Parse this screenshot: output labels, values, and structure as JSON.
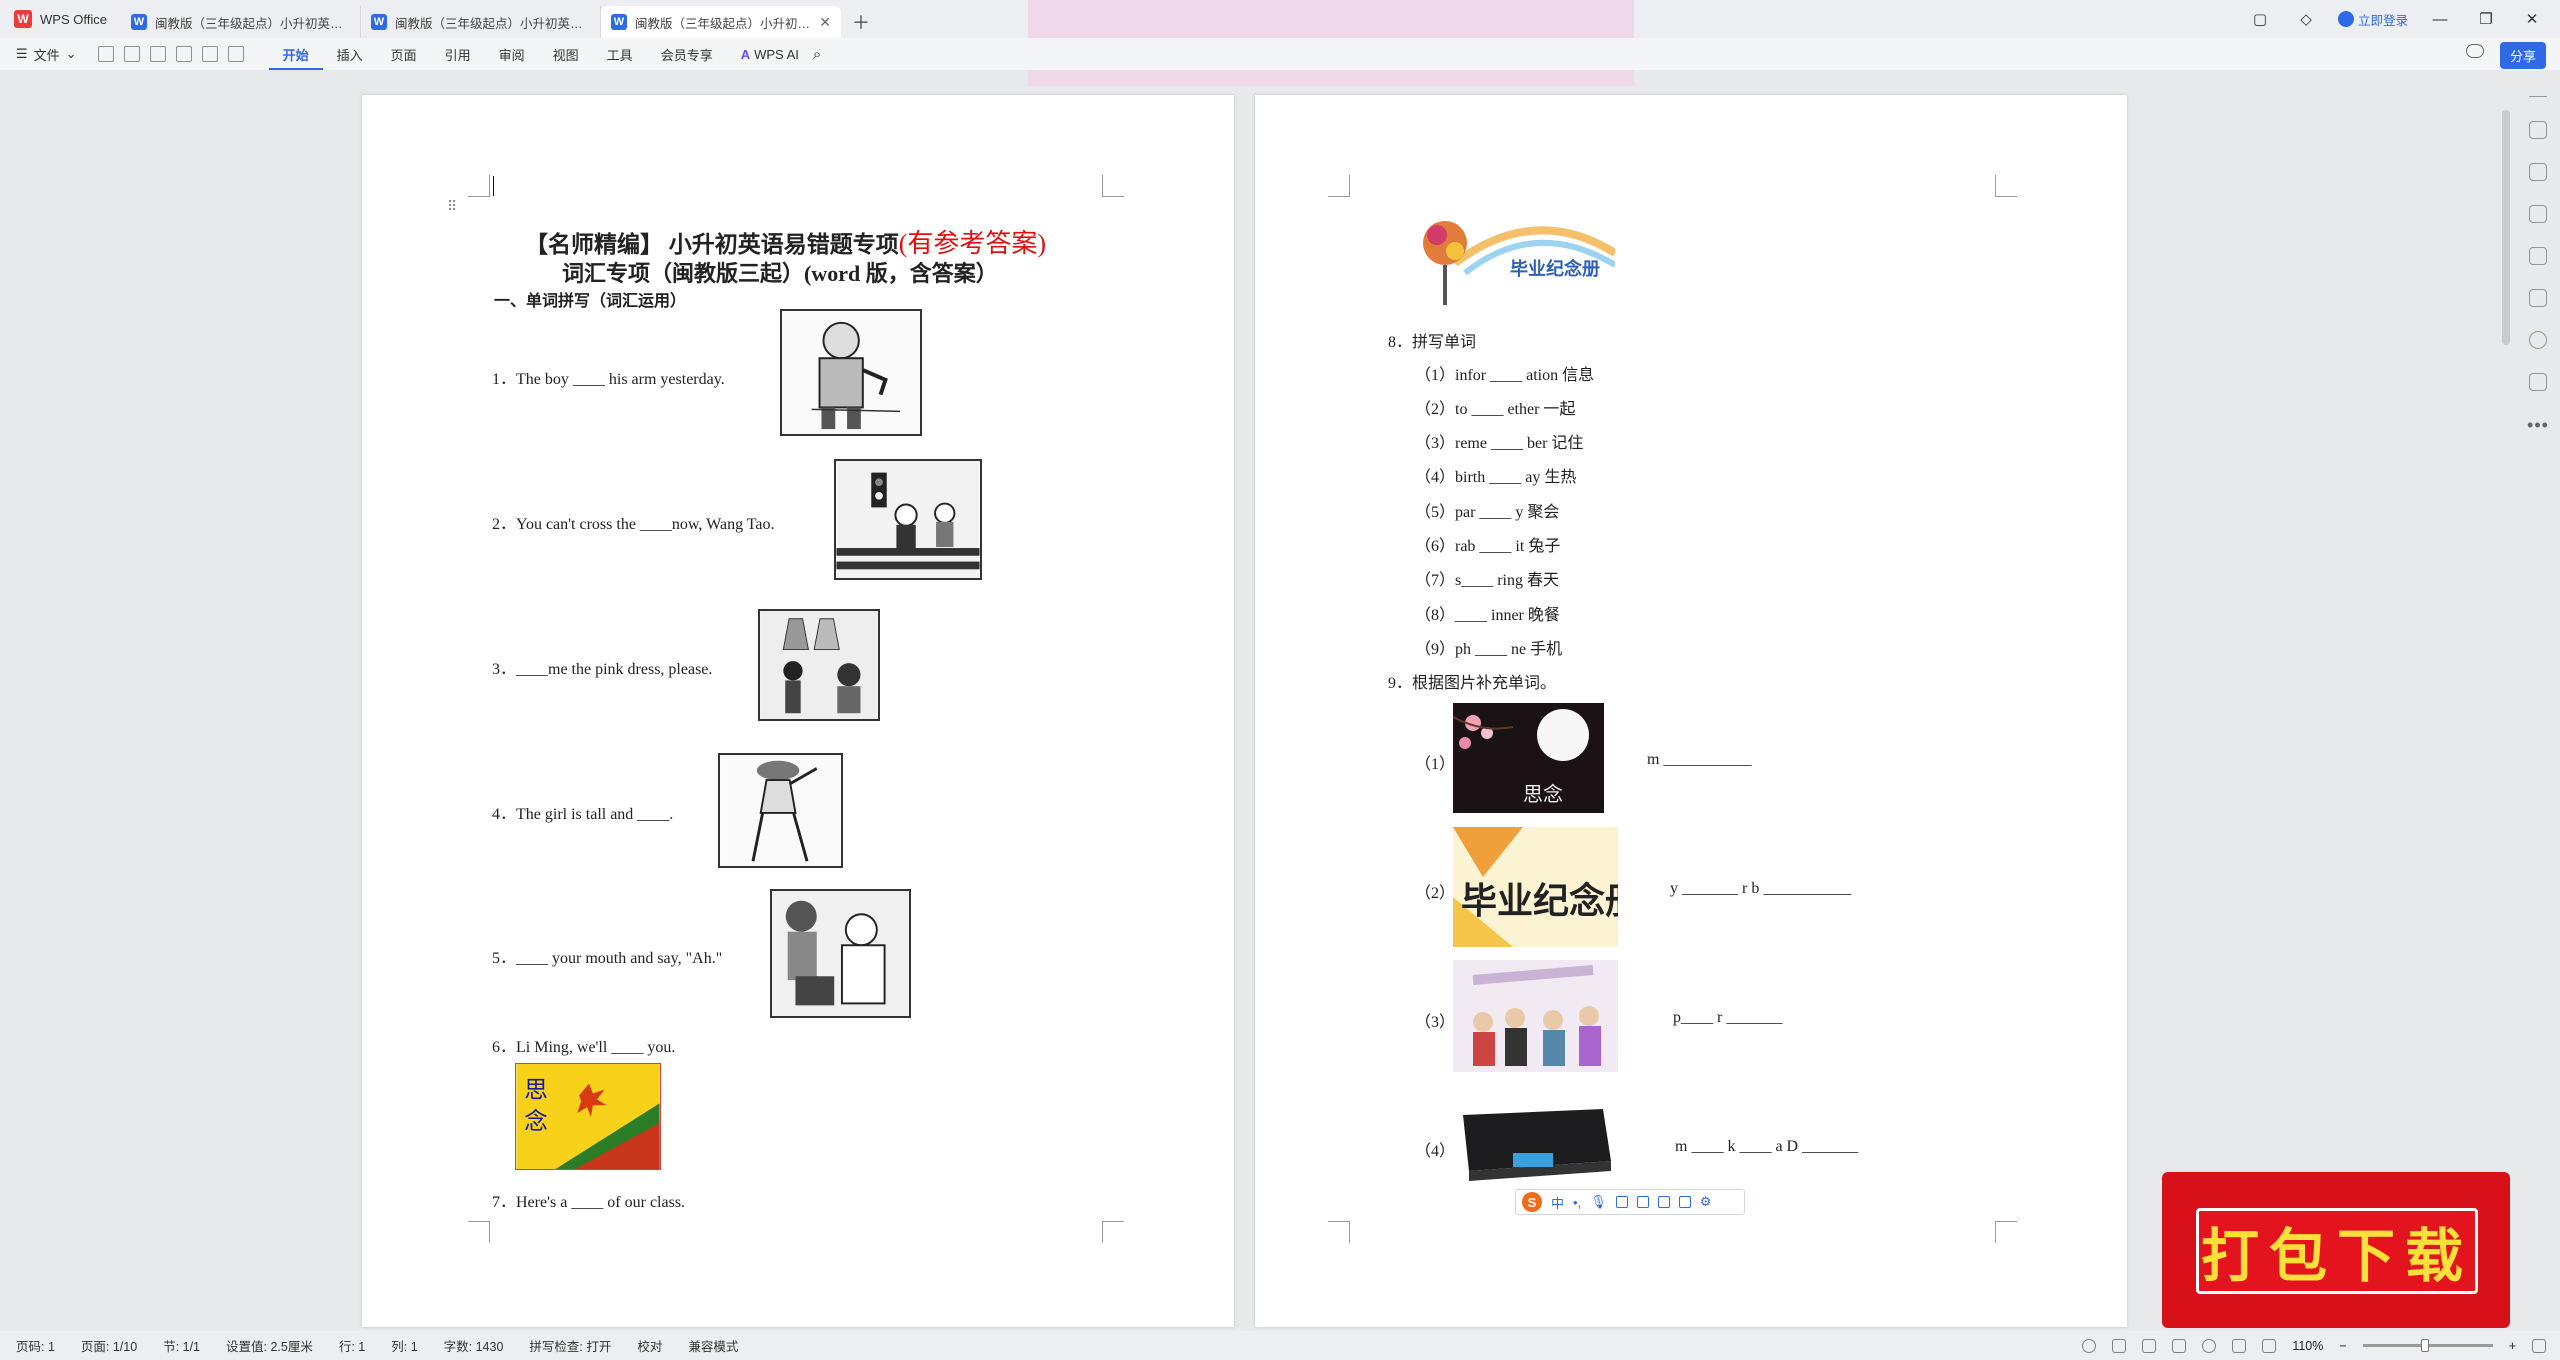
{
  "app": {
    "name": "WPS Office",
    "tabs": [
      {
        "label": "闽教版（三年级起点）小升初英语易错题专项"
      },
      {
        "label": "闽教版（三年级起点）小升初英语易错题专项"
      },
      {
        "label": "闽教版（三年级起点）小升初英语易错题专项"
      }
    ],
    "login": "立即登录"
  },
  "toolbar": {
    "file": "文件",
    "menus": [
      "开始",
      "插入",
      "页面",
      "引用",
      "审阅",
      "视图",
      "工具",
      "会员专享"
    ],
    "wps_ai": "WPS AI",
    "share": "分享"
  },
  "page1": {
    "title_bold": "【名师精编】 小升初英语易错题专项",
    "title_red": "(有参考答案)",
    "subtitle": "词汇专项（闽教版三起）(word 版，含答案）",
    "section": "一、单词拼写（词汇运用）",
    "questions": [
      "1．The boy  ____  his arm yesterday.",
      "2．You can't cross the  ____now, Wang Tao.",
      "3．____me the pink dress, please.",
      "4．The girl is tall and  ____.",
      "5．____  your mouth and say, \"Ah.\"",
      "6．Li Ming, we'll  ____  you.",
      "7．Here's a  ____  of our class."
    ],
    "image6_text": "思念"
  },
  "page2": {
    "banner_text": "毕业纪念册",
    "q8_title": "8．拼写单词",
    "q8_items": [
      "（1）infor ____ ation 信息",
      "（2）to ____ ether 一起",
      "（3）reme ____ ber 记住",
      "（4）birth ____ ay 生热",
      "（5）par ____ y 聚会",
      "（6）rab ____ it 兔子",
      "（7）s____ ring 春天",
      "（8）____ inner 晚餐",
      "（9）ph ____ ne 手机"
    ],
    "q9_title": "9．根据图片补充单词。",
    "q9_items": [
      {
        "num": "（1）",
        "blank": "m ___________"
      },
      {
        "num": "（2）",
        "blank": "y _______   r     b ___________"
      },
      {
        "num": "（3）",
        "blank": "p____  r _______"
      },
      {
        "num": "（4）",
        "blank": "m ____  k ____      a     D _______"
      }
    ],
    "img1_text": "思念",
    "img2_text": "毕业纪念册"
  },
  "ime": {
    "mode": "中"
  },
  "stamp": {
    "text": "打包下载"
  },
  "status": {
    "page": "页码: 1",
    "pages": "页面: 1/10",
    "section": "节: 1/1",
    "setting": "设置值: 2.5厘米",
    "row": "行: 1",
    "col": "列: 1",
    "words": "字数: 1430",
    "spell": "拼写检查: 打开",
    "proof": "校对",
    "compat": "兼容模式",
    "zoom": "110%"
  }
}
